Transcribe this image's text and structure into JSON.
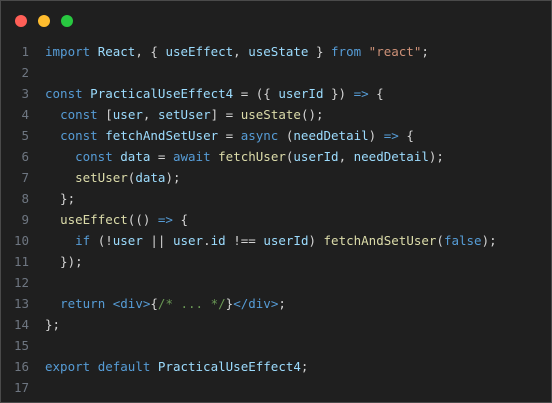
{
  "window": {
    "controls": [
      {
        "name": "close",
        "color": "#ff5f57"
      },
      {
        "name": "minimize",
        "color": "#febc2e"
      },
      {
        "name": "maximize",
        "color": "#28c840"
      }
    ]
  },
  "editor": {
    "lines": [
      {
        "number": "1",
        "tokens": [
          {
            "t": "import",
            "k": "keyword"
          },
          {
            "t": " ",
            "k": "plain"
          },
          {
            "t": "React",
            "k": "ident"
          },
          {
            "t": ", { ",
            "k": "punct"
          },
          {
            "t": "useEffect",
            "k": "ident"
          },
          {
            "t": ", ",
            "k": "punct"
          },
          {
            "t": "useState",
            "k": "ident"
          },
          {
            "t": " } ",
            "k": "punct"
          },
          {
            "t": "from",
            "k": "keyword"
          },
          {
            "t": " ",
            "k": "plain"
          },
          {
            "t": "\"react\"",
            "k": "string"
          },
          {
            "t": ";",
            "k": "punct"
          }
        ]
      },
      {
        "number": "2",
        "tokens": []
      },
      {
        "number": "3",
        "tokens": [
          {
            "t": "const",
            "k": "keyword"
          },
          {
            "t": " ",
            "k": "plain"
          },
          {
            "t": "PracticalUseEffect4",
            "k": "ident"
          },
          {
            "t": " = ({ ",
            "k": "punct"
          },
          {
            "t": "userId",
            "k": "ident"
          },
          {
            "t": " }) ",
            "k": "punct"
          },
          {
            "t": "=>",
            "k": "keyword"
          },
          {
            "t": " {",
            "k": "punct"
          }
        ]
      },
      {
        "number": "4",
        "tokens": [
          {
            "t": "  ",
            "k": "plain"
          },
          {
            "t": "const",
            "k": "keyword"
          },
          {
            "t": " [",
            "k": "punct"
          },
          {
            "t": "user",
            "k": "ident"
          },
          {
            "t": ", ",
            "k": "punct"
          },
          {
            "t": "setUser",
            "k": "ident"
          },
          {
            "t": "] = ",
            "k": "punct"
          },
          {
            "t": "useState",
            "k": "func"
          },
          {
            "t": "();",
            "k": "punct"
          }
        ]
      },
      {
        "number": "5",
        "tokens": [
          {
            "t": "  ",
            "k": "plain"
          },
          {
            "t": "const",
            "k": "keyword"
          },
          {
            "t": " ",
            "k": "plain"
          },
          {
            "t": "fetchAndSetUser",
            "k": "ident"
          },
          {
            "t": " = ",
            "k": "punct"
          },
          {
            "t": "async",
            "k": "keyword"
          },
          {
            "t": " (",
            "k": "punct"
          },
          {
            "t": "needDetail",
            "k": "ident"
          },
          {
            "t": ") ",
            "k": "punct"
          },
          {
            "t": "=>",
            "k": "keyword"
          },
          {
            "t": " {",
            "k": "punct"
          }
        ]
      },
      {
        "number": "6",
        "tokens": [
          {
            "t": "    ",
            "k": "plain"
          },
          {
            "t": "const",
            "k": "keyword"
          },
          {
            "t": " ",
            "k": "plain"
          },
          {
            "t": "data",
            "k": "ident"
          },
          {
            "t": " = ",
            "k": "punct"
          },
          {
            "t": "await",
            "k": "keyword"
          },
          {
            "t": " ",
            "k": "plain"
          },
          {
            "t": "fetchUser",
            "k": "func"
          },
          {
            "t": "(",
            "k": "punct"
          },
          {
            "t": "userId",
            "k": "ident"
          },
          {
            "t": ", ",
            "k": "punct"
          },
          {
            "t": "needDetail",
            "k": "ident"
          },
          {
            "t": ");",
            "k": "punct"
          }
        ]
      },
      {
        "number": "7",
        "tokens": [
          {
            "t": "    ",
            "k": "plain"
          },
          {
            "t": "setUser",
            "k": "func"
          },
          {
            "t": "(",
            "k": "punct"
          },
          {
            "t": "data",
            "k": "ident"
          },
          {
            "t": ");",
            "k": "punct"
          }
        ]
      },
      {
        "number": "8",
        "tokens": [
          {
            "t": "  };",
            "k": "punct"
          }
        ]
      },
      {
        "number": "9",
        "tokens": [
          {
            "t": "  ",
            "k": "plain"
          },
          {
            "t": "useEffect",
            "k": "func"
          },
          {
            "t": "(() ",
            "k": "punct"
          },
          {
            "t": "=>",
            "k": "keyword"
          },
          {
            "t": " {",
            "k": "punct"
          }
        ]
      },
      {
        "number": "10",
        "tokens": [
          {
            "t": "    ",
            "k": "plain"
          },
          {
            "t": "if",
            "k": "keyword"
          },
          {
            "t": " (!",
            "k": "punct"
          },
          {
            "t": "user",
            "k": "ident"
          },
          {
            "t": " || ",
            "k": "punct"
          },
          {
            "t": "user",
            "k": "ident"
          },
          {
            "t": ".",
            "k": "punct"
          },
          {
            "t": "id",
            "k": "ident"
          },
          {
            "t": " !== ",
            "k": "punct"
          },
          {
            "t": "userId",
            "k": "ident"
          },
          {
            "t": ") ",
            "k": "punct"
          },
          {
            "t": "fetchAndSetUser",
            "k": "func"
          },
          {
            "t": "(",
            "k": "punct"
          },
          {
            "t": "false",
            "k": "keyword"
          },
          {
            "t": ");",
            "k": "punct"
          }
        ]
      },
      {
        "number": "11",
        "tokens": [
          {
            "t": "  });",
            "k": "punct"
          }
        ]
      },
      {
        "number": "12",
        "tokens": []
      },
      {
        "number": "13",
        "tokens": [
          {
            "t": "  ",
            "k": "plain"
          },
          {
            "t": "return",
            "k": "keyword"
          },
          {
            "t": " ",
            "k": "plain"
          },
          {
            "t": "<div>",
            "k": "tag"
          },
          {
            "t": "{",
            "k": "punct"
          },
          {
            "t": "/* ... */",
            "k": "comment"
          },
          {
            "t": "}",
            "k": "punct"
          },
          {
            "t": "</div>",
            "k": "tag"
          },
          {
            "t": ";",
            "k": "punct"
          }
        ]
      },
      {
        "number": "14",
        "tokens": [
          {
            "t": "};",
            "k": "punct"
          }
        ]
      },
      {
        "number": "15",
        "tokens": []
      },
      {
        "number": "16",
        "tokens": [
          {
            "t": "export",
            "k": "keyword"
          },
          {
            "t": " ",
            "k": "plain"
          },
          {
            "t": "default",
            "k": "keyword"
          },
          {
            "t": " ",
            "k": "plain"
          },
          {
            "t": "PracticalUseEffect4",
            "k": "ident"
          },
          {
            "t": ";",
            "k": "punct"
          }
        ]
      },
      {
        "number": "17",
        "tokens": []
      }
    ]
  }
}
